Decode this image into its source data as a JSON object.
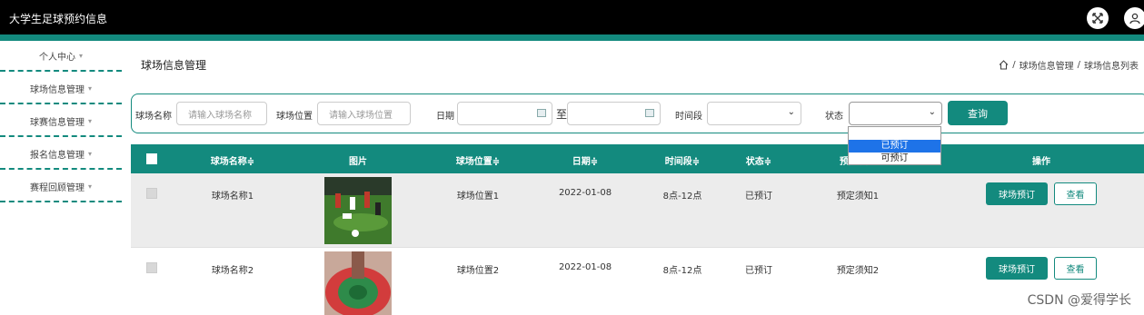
{
  "app_title": "大学生足球预约信息",
  "sidebar": {
    "items": [
      {
        "label": "个人中心"
      },
      {
        "label": "球场信息管理"
      },
      {
        "label": "球赛信息管理"
      },
      {
        "label": "报名信息管理"
      },
      {
        "label": "赛程回顾管理"
      }
    ]
  },
  "page_title": "球场信息管理",
  "breadcrumb": {
    "separator": "/",
    "items": [
      "球场信息管理",
      "球场信息列表"
    ]
  },
  "search": {
    "name_label": "球场名称",
    "name_placeholder": "请输入球场名称",
    "location_label": "球场位置",
    "location_placeholder": "请输入球场位置",
    "date_label": "日期",
    "date_sep": "至",
    "period_label": "时间段",
    "status_label": "状态",
    "query_button": "查询",
    "status_options": [
      "已预订",
      "可预订"
    ]
  },
  "table": {
    "columns": [
      "球场名称≑",
      "图片",
      "球场位置≑",
      "日期≑",
      "时间段≑",
      "状态≑",
      "预定须知",
      "操作"
    ],
    "rows": [
      {
        "name": "球场名称1",
        "location": "球场位置1",
        "date": "2022-01-08",
        "period": "8点-12点",
        "status": "已预订",
        "notice": "预定须知1",
        "book": "球场预订",
        "view": "查看"
      },
      {
        "name": "球场名称2",
        "location": "球场位置2",
        "date": "2022-01-08",
        "period": "8点-12点",
        "status": "已预订",
        "notice": "预定须知2",
        "book": "球场预订",
        "view": "查看"
      }
    ]
  },
  "watermark": "CSDN @爱得学长",
  "colors": {
    "accent": "#138a7e",
    "topbar": "#000000",
    "selected_option": "#1e73e8"
  }
}
